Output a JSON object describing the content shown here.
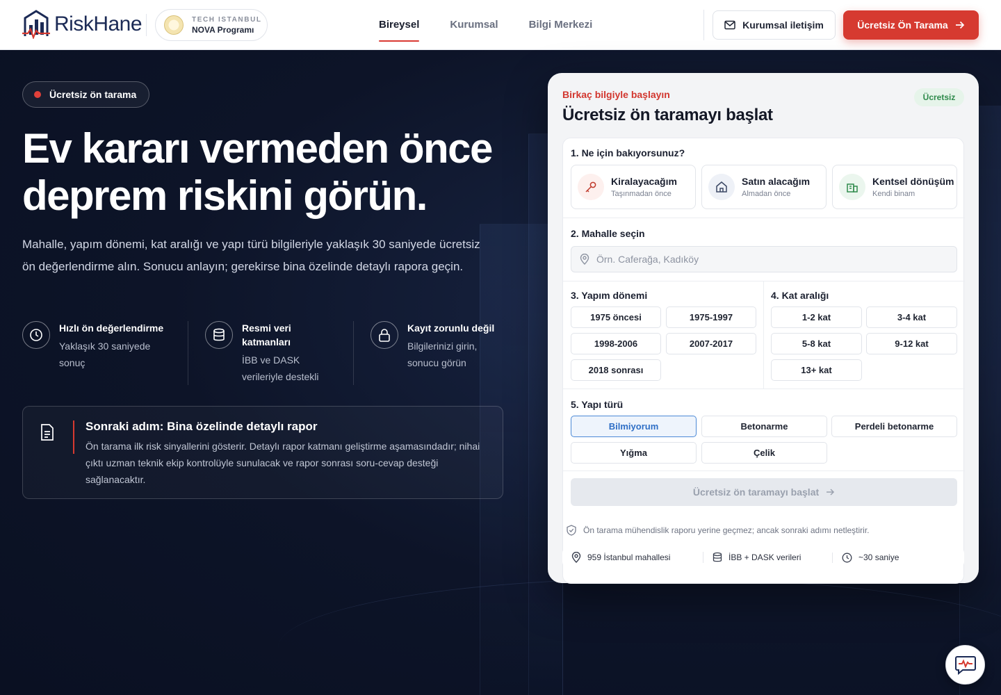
{
  "brand": {
    "name": "RiskHane",
    "program_top": "TECH ISTANBUL",
    "program_bottom": "NOVA Programı"
  },
  "nav": {
    "items": [
      {
        "label": "Bireysel",
        "active": true
      },
      {
        "label": "Kurumsal",
        "active": false
      },
      {
        "label": "Bilgi Merkezi",
        "active": false
      }
    ],
    "contact_label": "Kurumsal iletişim",
    "cta_label": "Ücretsiz Ön Tarama"
  },
  "hero": {
    "pill": "Ücretsiz ön tarama",
    "headline_line1": "Ev kararı vermeden önce",
    "headline_line2": "deprem riskini görün.",
    "lede": "Mahalle, yapım dönemi, kat aralığı ve yapı türü bilgileriyle yaklaşık 30 saniyede ücretsiz ön değerlendirme alın. Sonucu anlayın; gerekirse bina özelinde detaylı rapora geçin.",
    "features": [
      {
        "title": "Hızlı ön değerlendirme",
        "sub": "Yaklaşık 30 saniyede sonuç",
        "icon": "clock-icon"
      },
      {
        "title": "Resmi veri katmanları",
        "sub": "İBB ve DASK verileriyle destekli",
        "icon": "database-icon"
      },
      {
        "title": "Kayıt zorunlu değil",
        "sub": "Bilgilerinizi girin, sonucu görün",
        "icon": "lock-icon"
      }
    ],
    "next_title": "Sonraki adım: Bina özelinde detaylı rapor",
    "next_body": "Ön tarama ilk risk sinyallerini gösterir. Detaylı rapor katmanı geliştirme aşamasındadır; nihai çıktı uzman teknik ekip kontrolüyle sunulacak ve rapor sonrası soru-cevap desteği sağlanacaktır."
  },
  "form": {
    "kicker": "Birkaç bilgiyle başlayın",
    "title": "Ücretsiz ön taramayı başlat",
    "badge": "Ücretsiz",
    "q1_label": "1. Ne için bakıyorsunuz?",
    "purposes": [
      {
        "title": "Kiralayacağım",
        "sub": "Taşınmadan önce",
        "icon": "key-icon"
      },
      {
        "title": "Satın alacağım",
        "sub": "Almadan önce",
        "icon": "home-icon"
      },
      {
        "title": "Kentsel dönüşüm",
        "sub": "Kendi binam",
        "icon": "building-icon"
      }
    ],
    "q2_label": "2. Mahalle seçin",
    "search_placeholder": "Örn. Caferağa, Kadıköy",
    "q3_label": "3. Yapım dönemi",
    "periods": [
      "1975 öncesi",
      "1975-1997",
      "1998-2006",
      "2007-2017",
      "2018 sonrası"
    ],
    "q4_label": "4. Kat aralığı",
    "floors": [
      "1-2 kat",
      "3-4 kat",
      "5-8 kat",
      "9-12 kat",
      "13+ kat"
    ],
    "q5_label": "5. Yapı türü",
    "types": [
      "Bilmiyorum",
      "Betonarme",
      "Perdeli betonarme",
      "Yığma",
      "Çelik"
    ],
    "selected_type": "Bilmiyorum",
    "submit_label": "Ücretsiz ön taramayı başlat",
    "disclaimer": "Ön tarama mühendislik raporu yerine geçmez; ancak sonraki adımı netleştirir.",
    "stats": [
      {
        "label": "959 İstanbul mahallesi",
        "icon": "pin-icon"
      },
      {
        "label": "İBB + DASK verileri",
        "icon": "database-icon"
      },
      {
        "label": "~30 saniye",
        "icon": "clock-icon"
      }
    ]
  },
  "colors": {
    "accent": "#d63a30",
    "navy": "#0c1326",
    "selected": "#4b89d6",
    "success": "#2e8a4b"
  }
}
